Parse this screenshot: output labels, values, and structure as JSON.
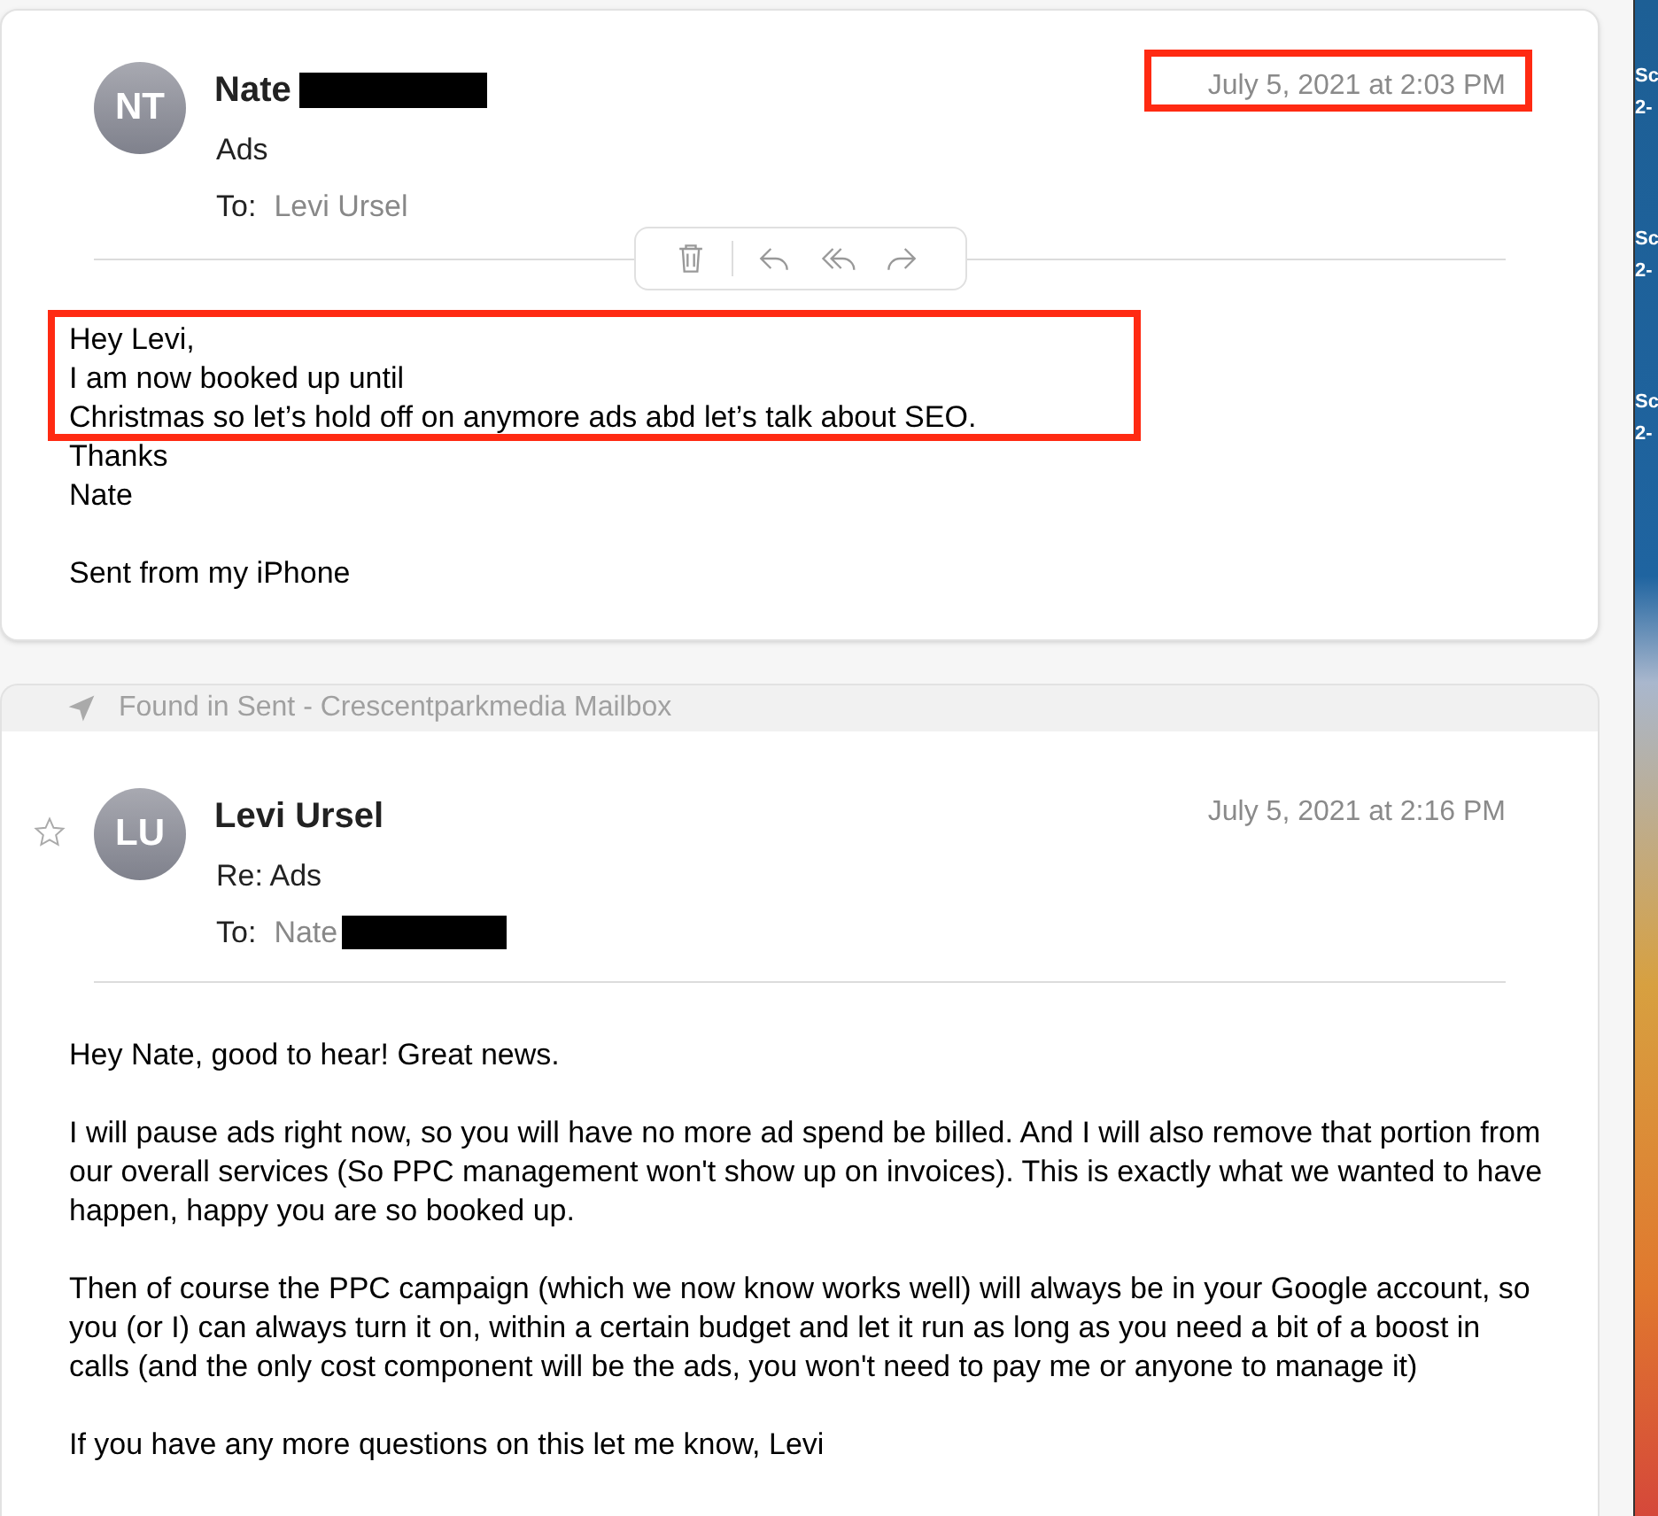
{
  "messages": [
    {
      "initials": "NT",
      "sender": "Nate",
      "sender_redacted": true,
      "subject": "Ads",
      "to_label": "To:",
      "recipient": "Levi Ursel",
      "recipient_redacted": false,
      "date": "July 5, 2021 at 2:03 PM",
      "date_highlighted": true,
      "toolbar": true,
      "body": [
        [
          {
            "text": "Hey Levi,",
            "highlighted": true
          },
          {
            "text": "I am now booked up until",
            "highlighted": true
          },
          {
            "text": "Christmas so let’s hold off on anymore ads abd let’s talk about SEO.",
            "highlighted": true
          },
          {
            "text": "Thanks",
            "highlighted": false
          },
          {
            "text": "Nate",
            "highlighted": false
          }
        ],
        [
          {
            "text": "Sent from my iPhone",
            "highlighted": false
          }
        ]
      ]
    },
    {
      "found_in": "Found in Sent - Crescentparkmedia Mailbox",
      "starred": false,
      "initials": "LU",
      "sender": "Levi Ursel",
      "sender_redacted": false,
      "subject": "Re: Ads",
      "to_label": "To:",
      "recipient": "Nate",
      "recipient_redacted": true,
      "date": "July 5, 2021 at 2:16 PM",
      "date_highlighted": false,
      "toolbar": false,
      "body": [
        [
          {
            "text": "Hey Nate, good to hear! Great news.",
            "highlighted": false
          }
        ],
        [
          {
            "text": "I will pause ads right now, so you will have no more ad spend be billed. And I will also remove that portion from our overall services (So PPC management won't show up on invoices). This is exactly what we wanted to have happen, happy you are so booked up.",
            "highlighted": false
          }
        ],
        [
          {
            "text": "Then of course the PPC campaign (which we now know works well) will always be in your Google account, so you (or I) can always turn it on, within a certain budget and let it run as long as you need a bit of a boost in calls (and the only cost component will be the ads, you won't need to pay me or anyone to manage it)",
            "highlighted": false
          }
        ],
        [
          {
            "text": "If you have any more questions on this let me know, Levi",
            "highlighted": false
          }
        ]
      ]
    }
  ],
  "desktop": {
    "labels": [
      "Sc",
      "2-",
      "Sc",
      "2-",
      "Sc",
      "2-"
    ]
  }
}
